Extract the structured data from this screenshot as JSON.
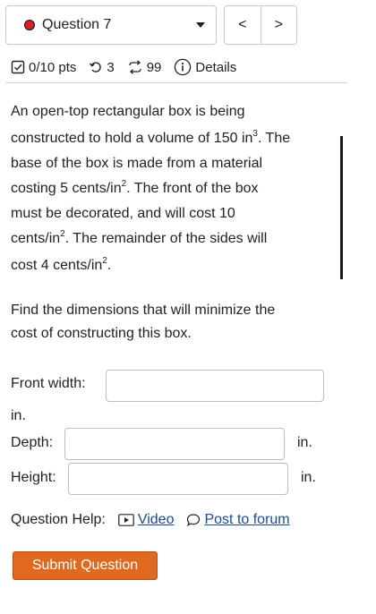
{
  "nav": {
    "question_label": "Question 7",
    "prev_label": "<",
    "next_label": ">"
  },
  "meta": {
    "points": "0/10 pts",
    "retries": "3",
    "attempts": "99",
    "details": "Details"
  },
  "question": {
    "lines": [
      "An open-top rectangular box is being",
      "constructed to hold a volume of 150 in",
      "base of the box is made from a material",
      "costing 5 cents/in",
      "must be decorated, and will cost 10",
      "cents/in",
      "cost 4 cents/in"
    ],
    "sup3": "3",
    "sup2": "2",
    "line2_tail": ". The",
    "line4_tail": ". The front of the box",
    "line6_tail": ". The remainder of the sides will",
    "line7_tail": ".",
    "find_lines": [
      "Find the dimensions that will minimize the",
      "cost of constructing this box."
    ]
  },
  "fields": {
    "front_width_label": "Front width:",
    "front_width_unit": "in.",
    "depth_label": "Depth:",
    "depth_unit": "in.",
    "height_label": "Height:",
    "height_unit": "in."
  },
  "help": {
    "label": "Question Help:",
    "video": "Video",
    "forum": "Post to forum"
  },
  "submit_label": "Submit Question",
  "colors": {
    "status_dot": "#d9202a",
    "submit_bg": "#e0681f",
    "link": "#1d4a8c"
  }
}
